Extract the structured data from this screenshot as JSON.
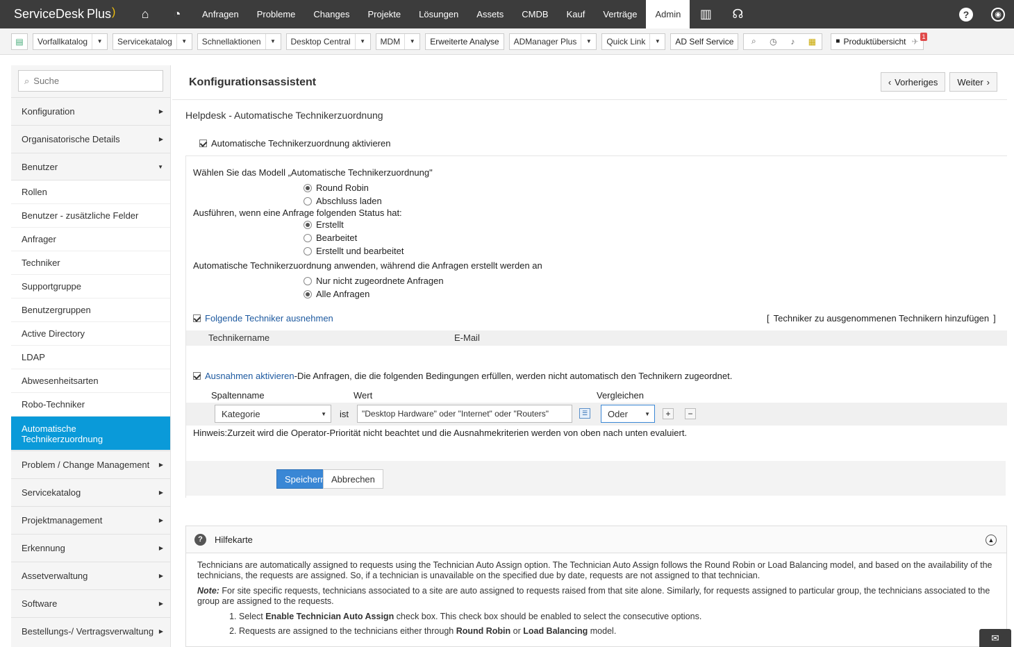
{
  "brand": {
    "name": "ServiceDesk",
    "plus": "Plus"
  },
  "topnav": {
    "items": [
      "Anfragen",
      "Probleme",
      "Changes",
      "Projekte",
      "Lösungen",
      "Assets",
      "CMDB",
      "Kauf",
      "Verträge",
      "Admin"
    ],
    "active": "Admin"
  },
  "toolbar": {
    "dropdowns": [
      "Vorfallkatalog",
      "Servicekatalog",
      "Schnellaktionen",
      "Desktop Central",
      "MDM"
    ],
    "button1": "Erweiterte Analyse",
    "dropdowns2": [
      "ADManager Plus",
      "Quick Link"
    ],
    "button2": "AD Self Service",
    "product": "Produktübersicht",
    "badge": "1"
  },
  "sidebar": {
    "search_placeholder": "Suche",
    "top": [
      "Konfiguration",
      "Organisatorische Details",
      "Benutzer"
    ],
    "sub": [
      "Rollen",
      "Benutzer - zusätzliche Felder",
      "Anfrager",
      "Techniker",
      "Supportgruppe",
      "Benutzergruppen",
      "Active Directory",
      "LDAP",
      "Abwesenheitsarten",
      "Robo-Techniker"
    ],
    "active_line1": "Automatische",
    "active_line2": "Technikerzuordnung",
    "bottom": [
      "Problem / Change Management",
      "Servicekatalog",
      "Projektmanagement",
      "Erkennung",
      "Assetverwaltung",
      "Software",
      "Bestellungs-/ Vertragsverwaltung"
    ]
  },
  "main": {
    "title": "Konfigurationsassistent",
    "prev": "Vorheriges",
    "next": "Weiter",
    "subtitle": "Helpdesk - Automatische Technikerzuordnung",
    "enable_label": "Automatische Technikerzuordnung aktivieren",
    "model_label": "Wählen Sie das Modell „Automatische Technikerzuordnung\"",
    "model_options": [
      "Round Robin",
      "Abschluss laden"
    ],
    "status_label": "Ausführen, wenn eine Anfrage folgenden Status hat:",
    "status_options": [
      "Erstellt",
      "Bearbeitet",
      "Erstellt und bearbeitet"
    ],
    "apply_label": "Automatische Technikerzuordnung anwenden, während die Anfragen erstellt werden an",
    "apply_options": [
      "Nur nicht zugeordnete Anfragen",
      "Alle Anfragen"
    ],
    "exclude_label": "Folgende Techniker ausnehmen",
    "exclude_add_link": "Techniker zu ausgenommenen Technikern hinzufügen",
    "col_name": "Technikername",
    "col_email": "E-Mail",
    "exceptions_link": "Ausnahmen aktivieren",
    "exceptions_text": "-Die Anfragen, die die folgenden Bedingungen erfüllen, werden nicht automatisch den Technikern zugeordnet.",
    "col_spalte": "Spaltenname",
    "col_wert": "Wert",
    "col_vergleichen": "Vergleichen",
    "criteria_column": "Kategorie",
    "criteria_op": "ist",
    "criteria_value": "\"Desktop Hardware\" oder \"Internet\" oder \"Routers\"",
    "criteria_compare": "Oder",
    "hint": "Hinweis:Zurzeit wird die Operator-Priorität nicht beachtet und die Ausnahmekriterien werden von oben nach unten evaluiert.",
    "save": "Speichern",
    "cancel": "Abbrechen"
  },
  "help": {
    "title": "Hilfekarte",
    "p1": "Technicians are automatically assigned to requests using the Technician Auto Assign option. The Technician Auto Assign follows the Round Robin or Load Balancing model, and based on the availability of the technicians, the requests are assigned. So, if a technician is unavailable on the specified due by date, requests are not assigned to that technician.",
    "note_label": "Note:",
    "note": " For site specific requests, technicians associated to a site are auto assigned to requests raised from that site alone. Similarly, for requests assigned to particular group, the technicians associated to the group are assigned to the requests.",
    "li1a": "Select ",
    "li1b": "Enable Technician Auto Assign",
    "li1c": " check box. This check box should be enabled to select the consecutive options.",
    "li2a": "Requests are assigned to the technicians either through ",
    "li2b": "Round Robin",
    "li2c": " or ",
    "li2d": "Load Balancing",
    "li2e": " model."
  }
}
